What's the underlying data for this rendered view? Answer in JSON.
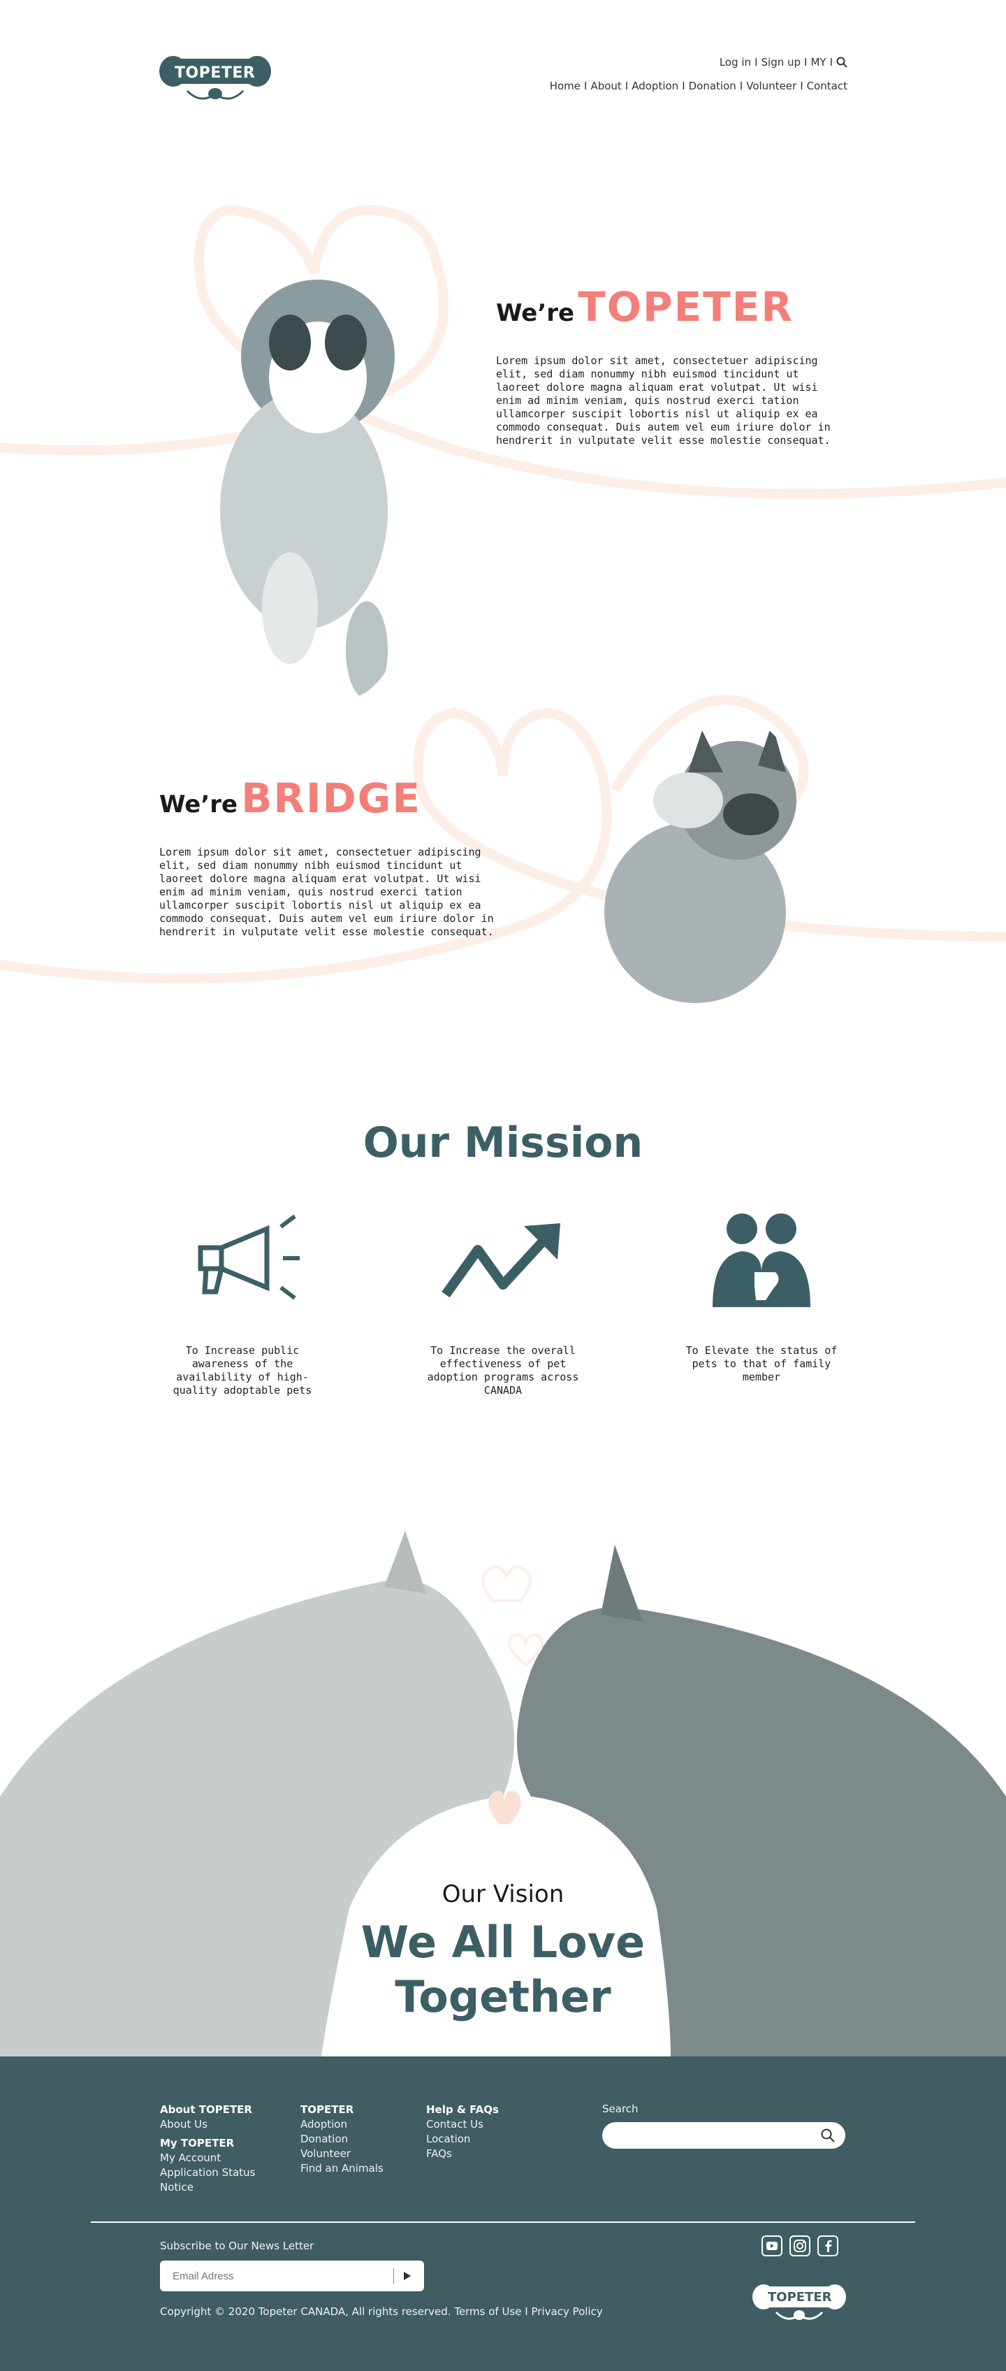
{
  "header": {
    "logo_text": "TOPETER",
    "util_nav": [
      "Log in",
      "Sign up",
      "MY"
    ],
    "main_nav": [
      "Home",
      "About",
      "Adoption",
      "Donation",
      "Volunteer",
      "Contact"
    ]
  },
  "hero1": {
    "prefix": "We’re",
    "brand": "TOPETER",
    "body": "Lorem ipsum dolor sit amet, consectetuer adipiscing elit, sed diam nonummy nibh euismod tincidunt ut laoreet dolore magna aliquam erat volutpat. Ut wisi enim ad minim veniam, quis nostrud exerci tation ullamcorper suscipit lobortis nisl ut aliquip ex ea commodo consequat. Duis autem vel eum iriure dolor in hendrerit in vulputate velit esse molestie consequat."
  },
  "hero2": {
    "prefix": "We’re",
    "brand": "BRIDGE",
    "body": "Lorem ipsum dolor sit amet, consectetuer adipiscing elit, sed diam nonummy nibh euismod tincidunt ut laoreet dolore magna aliquam erat volutpat. Ut wisi enim ad minim veniam, quis nostrud exerci tation ullamcorper suscipit lobortis nisl ut aliquip ex ea commodo consequat. Duis autem vel eum iriure dolor in hendrerit in vulputate velit esse molestie consequat."
  },
  "mission": {
    "title": "Our Mission",
    "items": [
      {
        "icon": "megaphone-icon",
        "text": "To Increase public awareness of the availability of high-quality adoptable pets"
      },
      {
        "icon": "trend-up-icon",
        "text": "To Increase the overall effectiveness of pet adoption programs across CANADA"
      },
      {
        "icon": "family-icon",
        "text": "To Elevate the status of pets to that of family member"
      }
    ]
  },
  "vision": {
    "label": "Our Vision",
    "title_line1": "We All Love",
    "title_line2": "Together"
  },
  "footer": {
    "col1": {
      "head": "About TOPETER",
      "links": [
        "About Us"
      ],
      "head2": "My TOPETER",
      "links2": [
        "My Account",
        "Application Status",
        "Notice"
      ]
    },
    "col2": {
      "head": "TOPETER",
      "links": [
        "Adoption",
        "Donation",
        "Volunteer",
        "Find an Animals"
      ]
    },
    "col3": {
      "head": "Help & FAQs",
      "links": [
        "Contact Us",
        "Location",
        "FAQs"
      ]
    },
    "search_label": "Search",
    "newsletter_label": "Subscribe to Our News Letter",
    "email_placeholder": "Email Adress",
    "copyright": "Copyright © 2020 Topeter CANADA, All rights reserved.",
    "terms": "Terms of Use",
    "privacy": "Privacy Policy",
    "logo_text": "TOPETER",
    "social": [
      "youtube-icon",
      "instagram-icon",
      "facebook-icon"
    ]
  },
  "colors": {
    "accent": "#f47e78",
    "teal": "#3c5f66",
    "footer_bg": "#3f5d63",
    "heart_line": "#fdeee6"
  }
}
